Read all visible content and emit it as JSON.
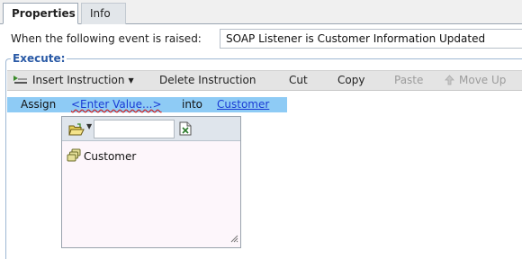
{
  "tabs": [
    {
      "label": "Properties",
      "active": true
    },
    {
      "label": "Info",
      "active": false
    }
  ],
  "event": {
    "label": "When the following event is raised:",
    "value": "SOAP Listener is Customer Information Updated"
  },
  "execute": {
    "legend": "Execute:"
  },
  "toolbar": {
    "insert_label": "Insert Instruction",
    "delete_label": "Delete Instruction",
    "cut_label": "Cut",
    "copy_label": "Copy",
    "paste_label": "Paste",
    "moveup_label": "Move Up"
  },
  "assign": {
    "keyword": "Assign",
    "value_placeholder": "<Enter Value...>",
    "into": "into",
    "target": "Customer"
  },
  "picker": {
    "search_value": "",
    "items": [
      {
        "label": "Customer",
        "icon": "object-stack-icon"
      }
    ]
  },
  "colors": {
    "accent": "#2a5aa6",
    "selection": "#8ecbf5",
    "link": "#1a3bd4"
  }
}
